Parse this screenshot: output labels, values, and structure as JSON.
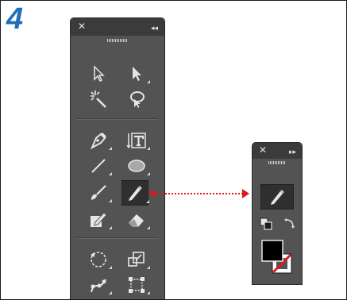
{
  "step": {
    "number": "4"
  },
  "toolbar_large": {
    "header": {
      "close_glyph": "✕",
      "collapse_glyph": "◂◂"
    },
    "tools": [
      {
        "icon": "selection-arrow-icon"
      },
      {
        "icon": "direct-selection-arrow-icon"
      },
      {
        "icon": "magic-wand-icon"
      },
      {
        "icon": "lasso-icon"
      },
      {
        "icon": "pen-icon"
      },
      {
        "icon": "type-icon"
      },
      {
        "icon": "line-segment-icon"
      },
      {
        "icon": "ellipse-icon"
      },
      {
        "icon": "paintbrush-icon"
      },
      {
        "icon": "pencil-icon",
        "selected": true
      },
      {
        "icon": "shaper-icon"
      },
      {
        "icon": "eraser-icon"
      },
      {
        "icon": "rotate-icon"
      },
      {
        "icon": "scale-icon"
      },
      {
        "icon": "puppet-warp-icon"
      },
      {
        "icon": "free-transform-icon"
      }
    ]
  },
  "toolbar_small": {
    "header": {
      "close_glyph": "✕",
      "expand_glyph": "▸▸"
    },
    "tools": [
      {
        "icon": "pencil-icon"
      },
      {
        "icon": "default-fill-stroke-icon"
      },
      {
        "icon": "swap-fill-stroke-icon"
      },
      {
        "icon": "fill-stroke-swatches-icon"
      }
    ]
  },
  "colors": {
    "panel": "#535353",
    "header": "#3b3b3b",
    "icon": "#d8d8d8",
    "arrow": "#e0181c",
    "step_number": "#1e6fb8"
  }
}
